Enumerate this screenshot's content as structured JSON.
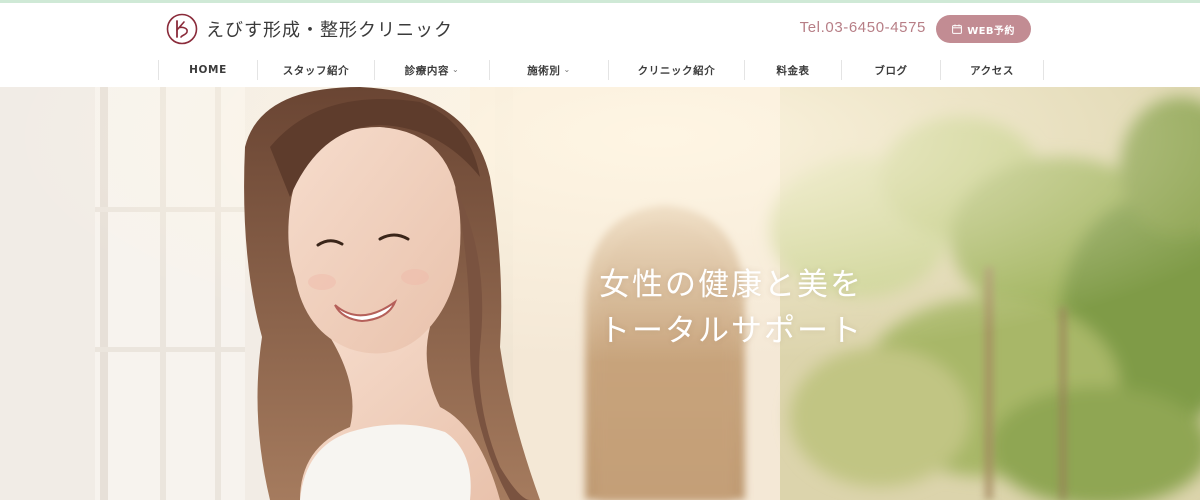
{
  "colors": {
    "top_accent": "#cfe9d6",
    "brand": "#8a2b3a",
    "tel_text": "#b77e86",
    "web_button": "#c28c93",
    "nav_text": "#3c3c3c",
    "headline": "#ffffff"
  },
  "header": {
    "logo": {
      "icon": "clinic-logo-ks-mark",
      "name": "えびす形成・整形クリニック"
    },
    "tel": "Tel.03-6450-4575",
    "web_button": {
      "icon": "calendar-icon",
      "label": "WEB予約"
    }
  },
  "nav": {
    "items": [
      {
        "label": "HOME",
        "dropdown": false
      },
      {
        "label": "スタッフ紹介",
        "dropdown": false
      },
      {
        "label": "診療内容",
        "dropdown": true
      },
      {
        "label": "施術別",
        "dropdown": true
      },
      {
        "label": "クリニック紹介",
        "dropdown": false
      },
      {
        "label": "料金表",
        "dropdown": false
      },
      {
        "label": "ブログ",
        "dropdown": false
      },
      {
        "label": "アクセス",
        "dropdown": false
      }
    ]
  },
  "hero": {
    "image": "smiling-woman-in-sunlit-room",
    "headline_line1": "女性の健康と美を",
    "headline_line2": "トータルサポート"
  }
}
